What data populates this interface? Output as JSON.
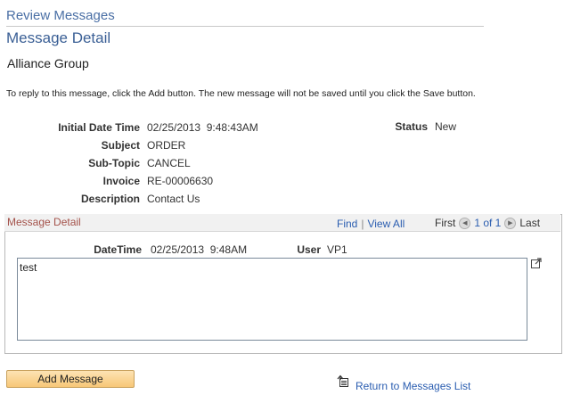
{
  "header": {
    "breadcrumb": "Review Messages",
    "title": "Message Detail",
    "company": "Alliance Group",
    "instructions": "To reply to this message, click the Add button. The new message will not be saved until you click the Save button."
  },
  "details": {
    "initial_datetime_label": "Initial Date Time",
    "initial_datetime_value": "02/25/2013  9:48:43AM",
    "status_label": "Status",
    "status_value": "New",
    "subject_label": "Subject",
    "subject_value": "ORDER",
    "subtopic_label": "Sub-Topic",
    "subtopic_value": "CANCEL",
    "invoice_label": "Invoice",
    "invoice_value": "RE-00006630",
    "description_label": "Description",
    "description_value": "Contact Us"
  },
  "grid": {
    "title": "Message Detail",
    "find": "Find",
    "separator": "|",
    "view_all": "View All",
    "first": "First",
    "position": "1 of 1",
    "last": "Last",
    "datetime_label": "DateTime",
    "datetime_value": "02/25/2013  9:48AM",
    "user_label": "User",
    "user_value": "VP1",
    "message_text": "test"
  },
  "icons": {
    "prev": "left-arrow-circle-icon",
    "next": "right-arrow-circle-icon",
    "expand": "expand-popup-icon",
    "return": "return-list-icon"
  },
  "actions": {
    "add_message": "Add Message",
    "return_link": "Return to Messages List"
  },
  "colors": {
    "link": "#2a5db0",
    "title": "#3a5f95",
    "grid_title": "#a4524a",
    "button": "#f7c777"
  }
}
